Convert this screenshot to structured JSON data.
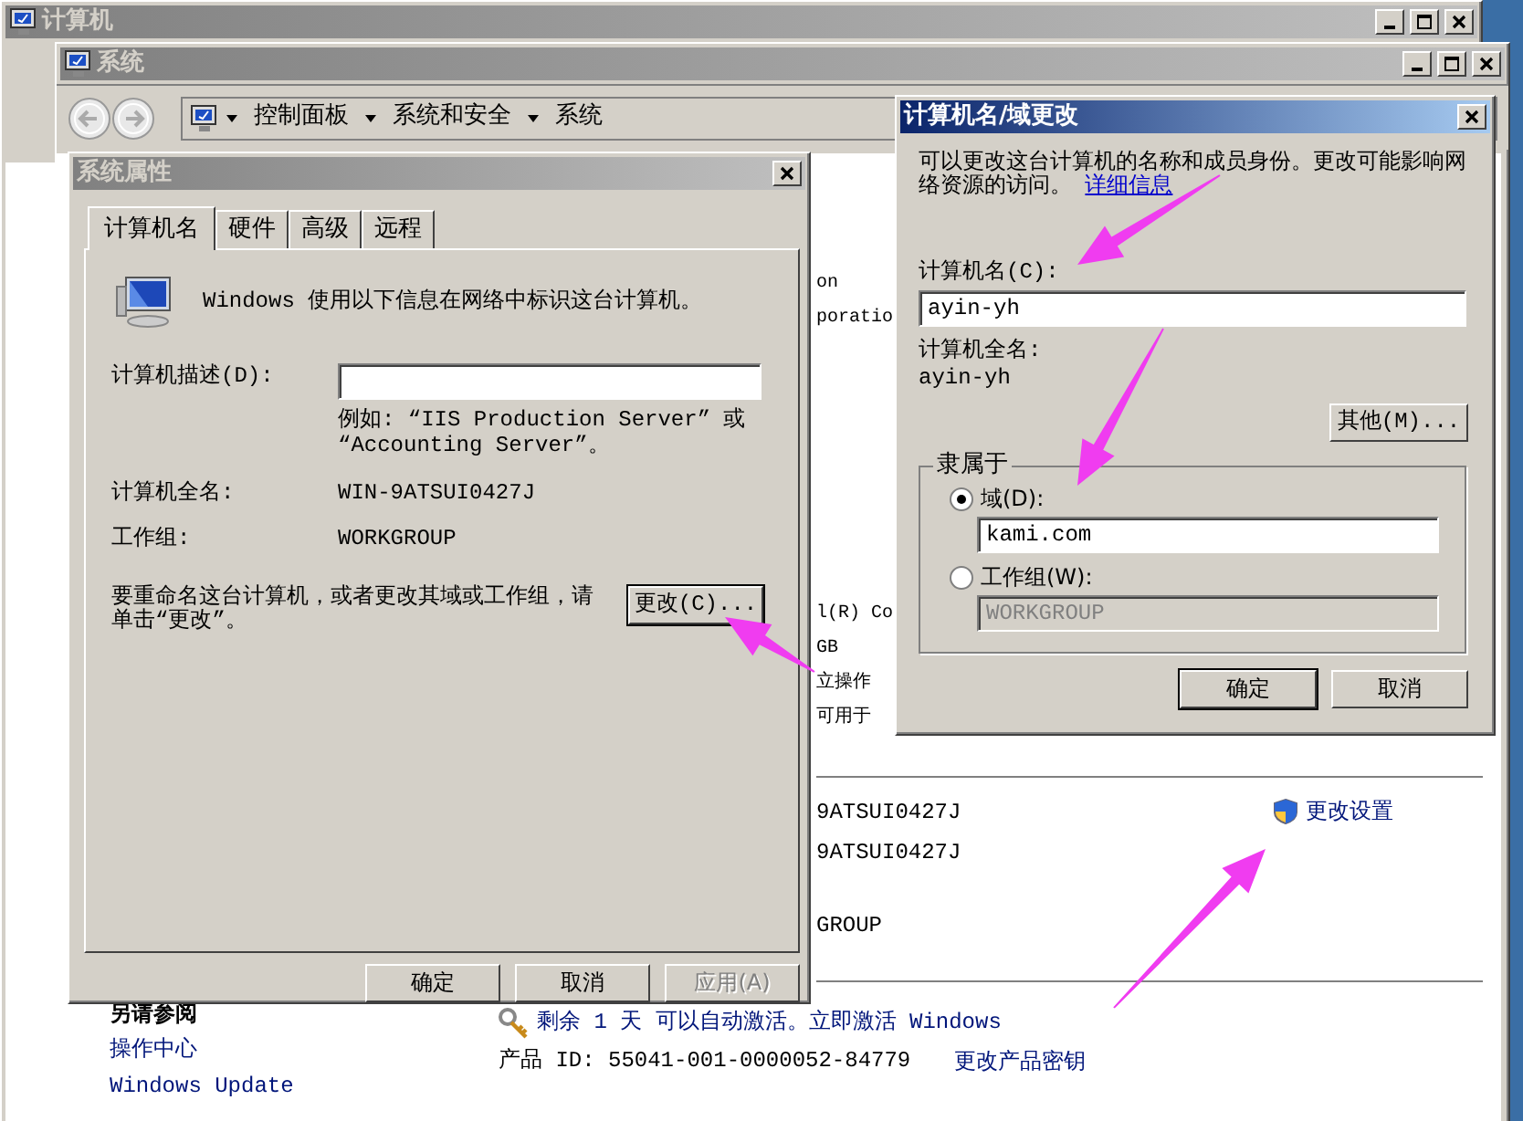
{
  "computer_window": {
    "title": "计算机"
  },
  "system_window": {
    "title": "系统",
    "breadcrumb": [
      "控制面板",
      "系统和安全",
      "系统"
    ],
    "upper_fragments": [
      "on",
      "poratio",
      "l(R) Co",
      "GB",
      "立操作",
      "可用于"
    ],
    "lower_fragments": [
      "9ATSUI0427J",
      "9ATSUI0427J",
      "GROUP"
    ],
    "change_settings_link": "更改设置",
    "see_also": {
      "heading": "另请参阅",
      "links": [
        "操作中心",
        "Windows Update"
      ]
    },
    "activation": {
      "text": "剩余 1 天 可以自动激活。立即激活 Windows",
      "product_id": "产品 ID: 55041-001-0000052-84779",
      "change_key_link": "更改产品密钥"
    }
  },
  "system_properties": {
    "title": "系统属性",
    "tabs": [
      {
        "label": "计算机名",
        "selected": true
      },
      {
        "label": "硬件",
        "selected": false
      },
      {
        "label": "高级",
        "selected": false
      },
      {
        "label": "远程",
        "selected": false
      }
    ],
    "intro": "Windows 使用以下信息在网络中标识这台计算机。",
    "description_label": "计算机描述(D):",
    "example": "例如: “IIS Production Server” 或 “Accounting Server”。",
    "full_name_label": "计算机全名:",
    "full_name": "WIN-9ATSUI0427J",
    "workgroup_label": "工作组:",
    "workgroup": "WORKGROUP",
    "rename_text": "要重命名这台计算机，或者更改其域或工作组，请单击“更改”。",
    "change_button": "更改(C)...",
    "buttons": [
      {
        "label": "确定",
        "disabled": false
      },
      {
        "label": "取消",
        "disabled": false
      },
      {
        "label": "应用(A)",
        "disabled": true
      }
    ]
  },
  "name_change_dialog": {
    "title": "计算机名/域更改",
    "description": "可以更改这台计算机的名称和成员身份。更改可能影响网络资源的访问。",
    "details_link": "详细信息",
    "computer_name_label": "计算机名(C):",
    "computer_name": "ayin-yh",
    "full_name_label": "计算机全名:",
    "full_name": "ayin-yh",
    "more_button": "其他(M)...",
    "member_of": {
      "legend": "隶属于",
      "options": [
        {
          "label": "域(D):",
          "selected": true,
          "value": "kami.com"
        },
        {
          "label": "工作组(W):",
          "selected": false,
          "value": "WORKGROUP"
        }
      ]
    },
    "buttons": [
      "确定",
      "取消"
    ]
  }
}
